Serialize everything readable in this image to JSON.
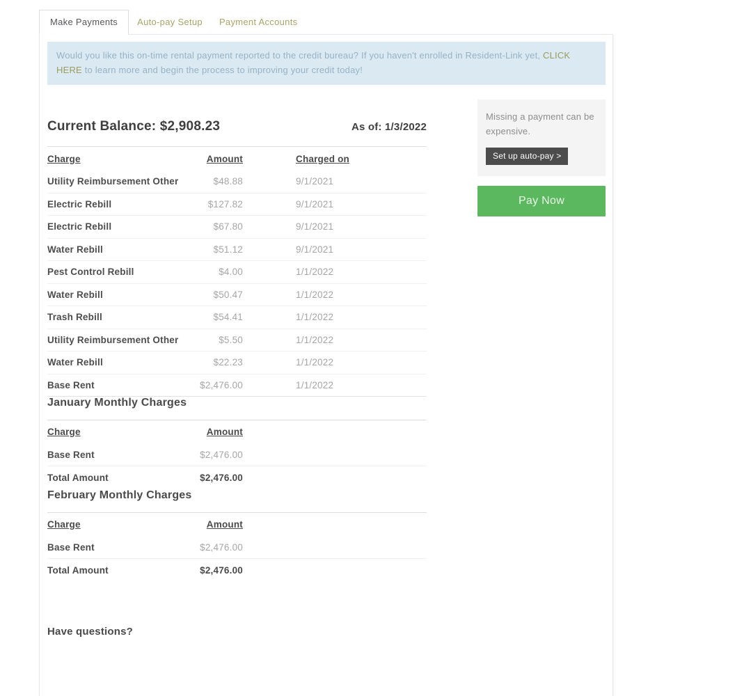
{
  "tabs": [
    {
      "label": "Make Payments"
    },
    {
      "label": "Auto-pay Setup"
    },
    {
      "label": "Payment Accounts"
    }
  ],
  "banner": {
    "text_before": "Would you like this on-time rental payment reported to the credit bureau?  If you haven't enrolled in Resident-Link yet, ",
    "link_text": "CLICK HERE",
    "text_after": " to learn more and begin the process to improving your credit today!"
  },
  "balance": {
    "title": "Current Balance: $2,908.23",
    "as_of": "As of: 1/3/2022",
    "headers": {
      "charge": "Charge",
      "amount": "Amount",
      "charged_on": "Charged on"
    },
    "rows": [
      {
        "charge": "Utility Reimbursement Other",
        "amount": "$48.88",
        "charged_on": "9/1/2021"
      },
      {
        "charge": "Electric Rebill",
        "amount": "$127.82",
        "charged_on": "9/1/2021"
      },
      {
        "charge": "Electric Rebill",
        "amount": "$67.80",
        "charged_on": "9/1/2021"
      },
      {
        "charge": "Water Rebill",
        "amount": "$51.12",
        "charged_on": "9/1/2021"
      },
      {
        "charge": "Pest Control Rebill",
        "amount": "$4.00",
        "charged_on": "1/1/2022"
      },
      {
        "charge": "Water Rebill",
        "amount": "$50.47",
        "charged_on": "1/1/2022"
      },
      {
        "charge": "Trash Rebill",
        "amount": "$54.41",
        "charged_on": "1/1/2022"
      },
      {
        "charge": "Utility Reimbursement Other",
        "amount": "$5.50",
        "charged_on": "1/1/2022"
      },
      {
        "charge": "Water Rebill",
        "amount": "$22.23",
        "charged_on": "1/1/2022"
      },
      {
        "charge": "Base Rent",
        "amount": "$2,476.00",
        "charged_on": "1/1/2022"
      }
    ]
  },
  "monthly_headers": {
    "charge": "Charge",
    "amount": "Amount"
  },
  "monthly_sections": [
    {
      "title": "January Monthly Charges",
      "row_charge": "Base Rent",
      "row_amount": "$2,476.00",
      "total_label": "Total Amount",
      "total_amount": "$2,476.00"
    },
    {
      "title": "February Monthly Charges",
      "row_charge": "Base Rent",
      "row_amount": "$2,476.00",
      "total_label": "Total Amount",
      "total_amount": "$2,476.00"
    }
  ],
  "sidebar": {
    "note": "Missing a payment can be expensive.",
    "autopay_button": "Set up auto-pay >",
    "pay_now_button": "Pay Now"
  },
  "footer": {
    "questions": "Have questions?"
  },
  "colors": {
    "accent_green": "#5cb85e",
    "banner_bg": "#dbe9f2",
    "banner_text": "#96b2c5",
    "link_olive": "#9b9b5e",
    "tab_inactive": "#a9a469",
    "dark_button": "#4c4c4c"
  }
}
